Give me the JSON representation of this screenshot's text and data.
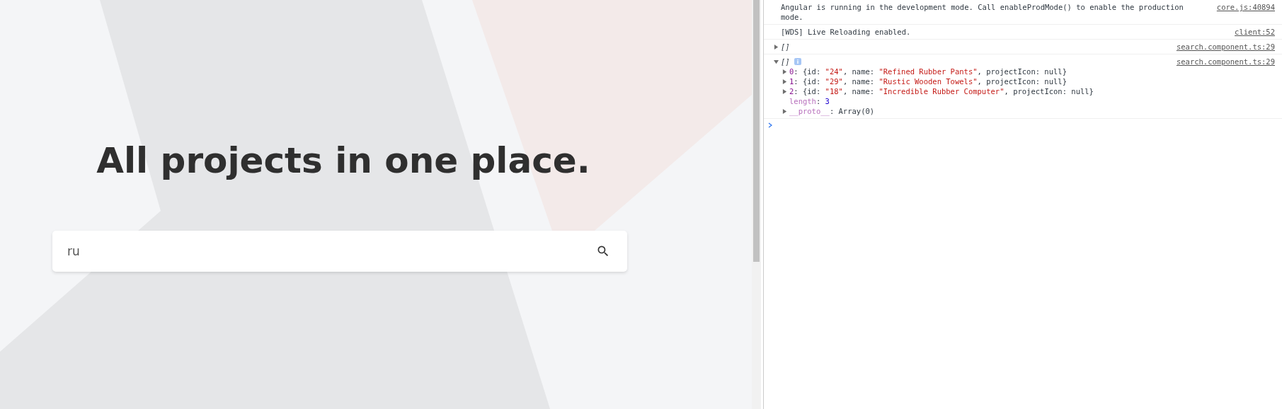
{
  "page": {
    "heading": "All projects in one place.",
    "search": {
      "value": "ru"
    }
  },
  "console": {
    "messages": [
      {
        "kind": "text",
        "text": "Angular is running in the development mode. Call enableProdMode() to enable the production mode.",
        "source": "core.js:40894"
      },
      {
        "kind": "text",
        "text": "[WDS] Live Reloading enabled.",
        "source": "client:52"
      },
      {
        "kind": "array",
        "label": "[]",
        "expanded": false,
        "source": "search.component.ts:29"
      },
      {
        "kind": "array",
        "label": "[]",
        "expanded": true,
        "source": "search.component.ts:29",
        "children": [
          {
            "kind": "entry",
            "expanded": false,
            "segments": [
              {
                "kind": "key",
                "text": "0"
              },
              {
                "kind": "plain",
                "text": ": {id: "
              },
              {
                "kind": "string",
                "text": "\"24\""
              },
              {
                "kind": "plain",
                "text": ", name: "
              },
              {
                "kind": "string",
                "text": "\"Refined Rubber Pants\""
              },
              {
                "kind": "plain",
                "text": ", projectIcon: null}"
              }
            ]
          },
          {
            "kind": "entry",
            "expanded": false,
            "segments": [
              {
                "kind": "key",
                "text": "1"
              },
              {
                "kind": "plain",
                "text": ": {id: "
              },
              {
                "kind": "string",
                "text": "\"29\""
              },
              {
                "kind": "plain",
                "text": ", name: "
              },
              {
                "kind": "string",
                "text": "\"Rustic Wooden Towels\""
              },
              {
                "kind": "plain",
                "text": ", projectIcon: null}"
              }
            ]
          },
          {
            "kind": "entry",
            "expanded": false,
            "segments": [
              {
                "kind": "key",
                "text": "2"
              },
              {
                "kind": "plain",
                "text": ": {id: "
              },
              {
                "kind": "string",
                "text": "\"18\""
              },
              {
                "kind": "plain",
                "text": ", name: "
              },
              {
                "kind": "string",
                "text": "\"Incredible Rubber Computer\""
              },
              {
                "kind": "plain",
                "text": ", projectIcon: null}"
              }
            ]
          },
          {
            "kind": "prop",
            "segments": [
              {
                "kind": "meta",
                "text": "length"
              },
              {
                "kind": "plain",
                "text": ": "
              },
              {
                "kind": "number",
                "text": "3"
              }
            ]
          },
          {
            "kind": "entry",
            "expanded": false,
            "segments": [
              {
                "kind": "meta",
                "text": "__proto__"
              },
              {
                "kind": "plain",
                "text": ": Array(0)"
              }
            ]
          }
        ]
      }
    ]
  }
}
